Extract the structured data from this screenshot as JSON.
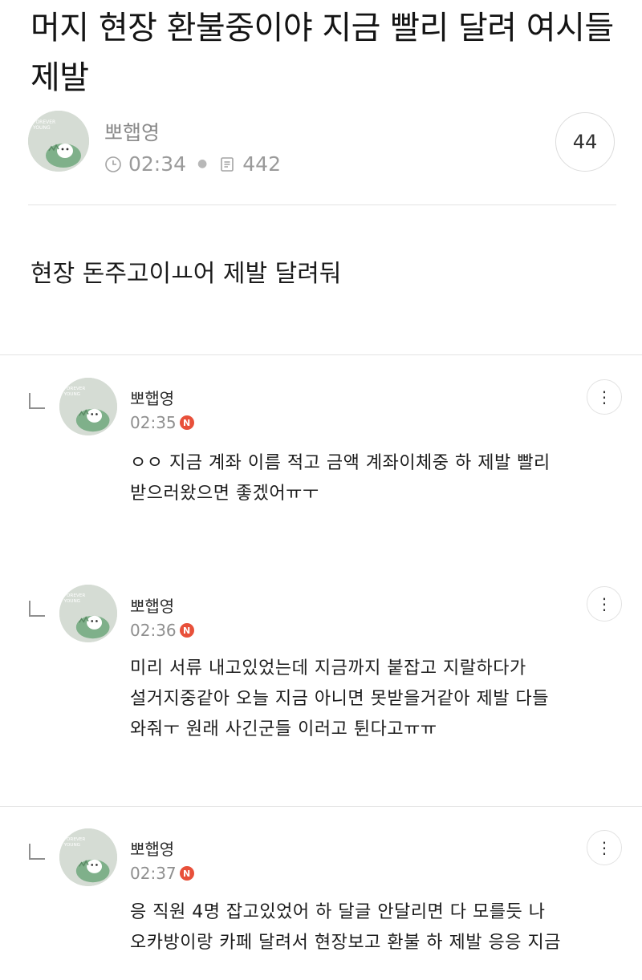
{
  "post": {
    "title": "머지 현장 환불중이야 지금 빨리 달려 여시들 제발",
    "author": "뽀햅영",
    "time": "02:34",
    "views": "442",
    "comment_count": "44",
    "body": "현장 돈주고이ㅛ어 제발 달려둬",
    "avatar_text": "FOREVER YOUNG"
  },
  "comments": [
    {
      "author": "뽀햅영",
      "time": "02:35",
      "badge": "N",
      "lines": [
        "ㅇㅇ 지금 계좌 이름 적고 금액 계좌이체중 하 제발 빨리",
        "받으러왔으면 좋겠어ㅠㅜ"
      ]
    },
    {
      "author": "뽀햅영",
      "time": "02:36",
      "badge": "N",
      "lines": [
        "미리 서류 내고있었는데 지금까지 붙잡고 지랄하다가",
        "설거지중같아 오늘 지금 아니면 못받을거같아 제발 다들",
        "와줘ㅜ 원래 사긴군들 이러고 튄다고ㅠㅠ"
      ]
    },
    {
      "author": "뽀햅영",
      "time": "02:37",
      "badge": "N",
      "lines": [
        "응 직원 4명 잡고있었어 하 달글 안달리면 다 모를듯 나",
        "오카방이랑 카페 달려서 현장보고 환불 하 제발 응응 지금"
      ]
    }
  ],
  "icons": {
    "clock": "clock-icon",
    "views": "document-icon",
    "more": "more-vertical-icon",
    "reply": "reply-corner-icon"
  },
  "colors": {
    "new_badge": "#e8503a",
    "avatar_bg": "#d5dcd4",
    "dino": "#7fb08a"
  }
}
